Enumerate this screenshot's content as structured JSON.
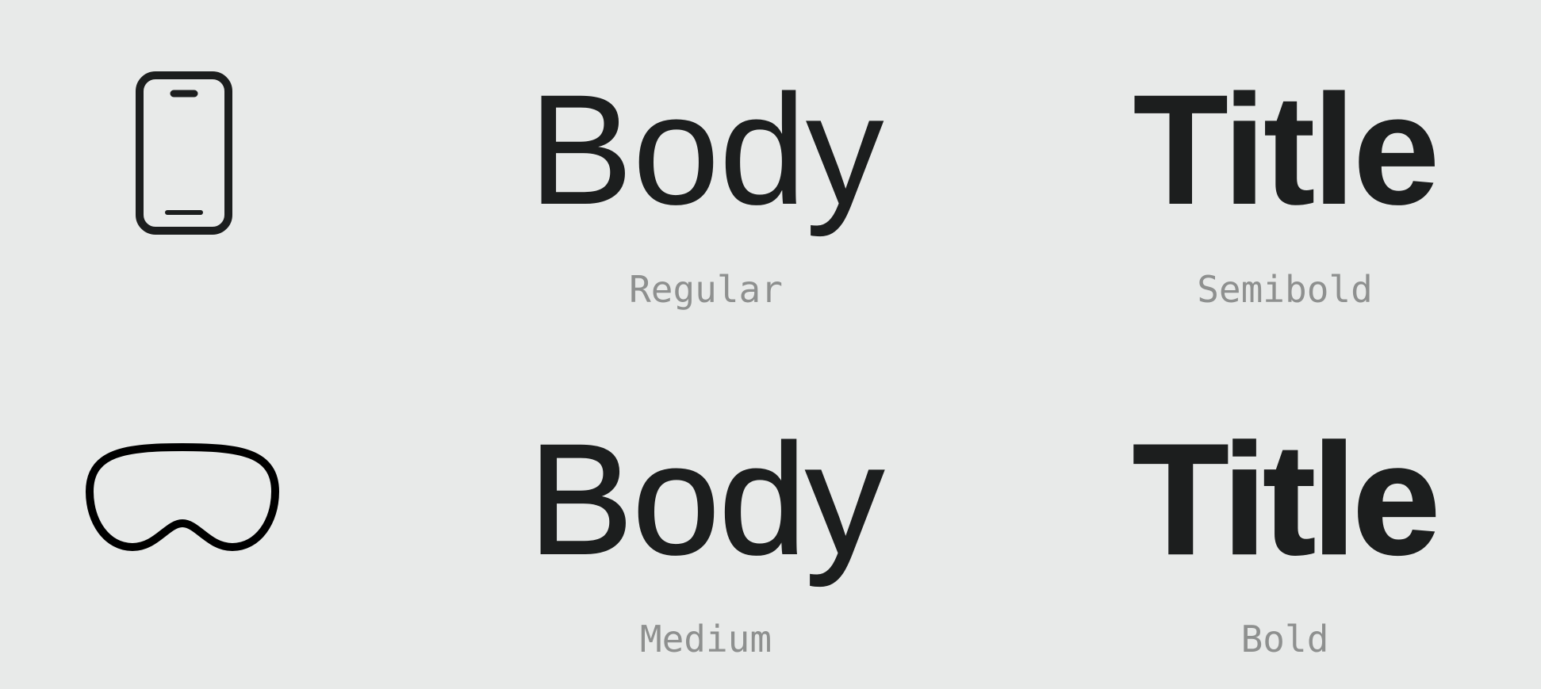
{
  "colors": {
    "background": "#e8eae9",
    "text": "#1c1e1e",
    "caption": "#8e908f",
    "icon_stroke": "#1c1e1e"
  },
  "rows": [
    {
      "icon": "iphone-icon",
      "samples": [
        {
          "word": "Body",
          "weight_label": "Regular"
        },
        {
          "word": "Title",
          "weight_label": "Semibold"
        }
      ]
    },
    {
      "icon": "vision-pro-headset-icon",
      "samples": [
        {
          "word": "Body",
          "weight_label": "Medium"
        },
        {
          "word": "Title",
          "weight_label": "Bold"
        }
      ]
    }
  ]
}
